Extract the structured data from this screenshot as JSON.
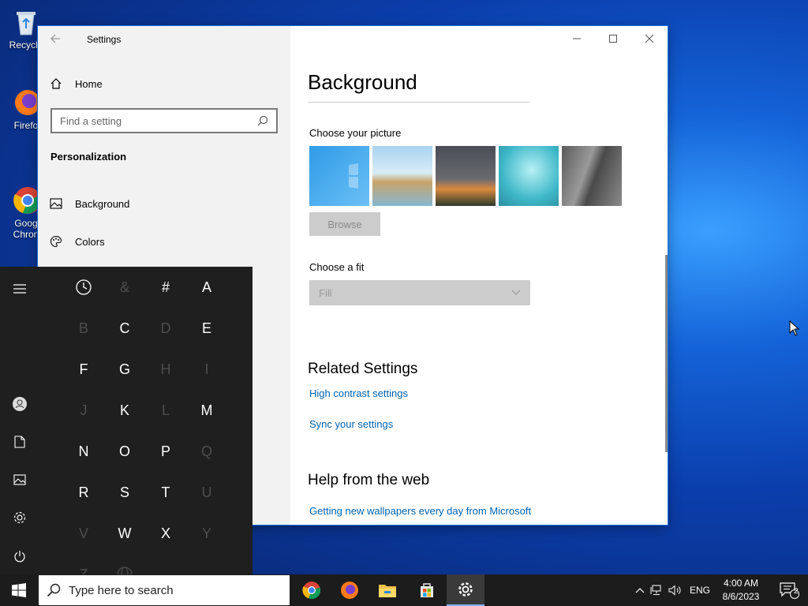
{
  "desktop": {
    "icons": [
      {
        "label": "Recycle"
      },
      {
        "label": "Firefo"
      },
      {
        "label": "Goog\nChron"
      }
    ]
  },
  "settings": {
    "app_title": "Settings",
    "home_label": "Home",
    "search_placeholder": "Find a setting",
    "section_heading": "Personalization",
    "nav_items": [
      {
        "label": "Background"
      },
      {
        "label": "Colors"
      }
    ],
    "page_title": "Background",
    "choose_picture_label": "Choose your picture",
    "browse_label": "Browse",
    "choose_fit_label": "Choose a fit",
    "fit_value": "Fill",
    "related_heading": "Related Settings",
    "related_links": [
      "High contrast settings",
      "Sync your settings"
    ],
    "help_heading": "Help from the web",
    "help_links": [
      "Getting new wallpapers every day from Microsoft"
    ]
  },
  "start_menu": {
    "letters": [
      {
        "char": "&",
        "enabled": false
      },
      {
        "char": "#",
        "enabled": true
      },
      {
        "char": "A",
        "enabled": true
      },
      {
        "char": "B",
        "enabled": false
      },
      {
        "char": "C",
        "enabled": true
      },
      {
        "char": "D",
        "enabled": false
      },
      {
        "char": "E",
        "enabled": true
      },
      {
        "char": "F",
        "enabled": true
      },
      {
        "char": "G",
        "enabled": true
      },
      {
        "char": "H",
        "enabled": false
      },
      {
        "char": "I",
        "enabled": false
      },
      {
        "char": "J",
        "enabled": false
      },
      {
        "char": "K",
        "enabled": true
      },
      {
        "char": "L",
        "enabled": false
      },
      {
        "char": "M",
        "enabled": true
      },
      {
        "char": "N",
        "enabled": true
      },
      {
        "char": "O",
        "enabled": true
      },
      {
        "char": "P",
        "enabled": true
      },
      {
        "char": "Q",
        "enabled": false
      },
      {
        "char": "R",
        "enabled": true
      },
      {
        "char": "S",
        "enabled": true
      },
      {
        "char": "T",
        "enabled": true
      },
      {
        "char": "U",
        "enabled": false
      },
      {
        "char": "V",
        "enabled": false
      },
      {
        "char": "W",
        "enabled": true
      },
      {
        "char": "X",
        "enabled": true
      },
      {
        "char": "Y",
        "enabled": false
      },
      {
        "char": "Z",
        "enabled": false
      }
    ]
  },
  "taskbar": {
    "search_placeholder": "Type here to search",
    "language": "ENG",
    "time": "4:00 AM",
    "date": "8/6/2023",
    "notification_count": "2"
  },
  "colors": {
    "accent": "#0063b1",
    "taskbar": "#1c1c1c",
    "start_bg": "#1f1f1f"
  }
}
